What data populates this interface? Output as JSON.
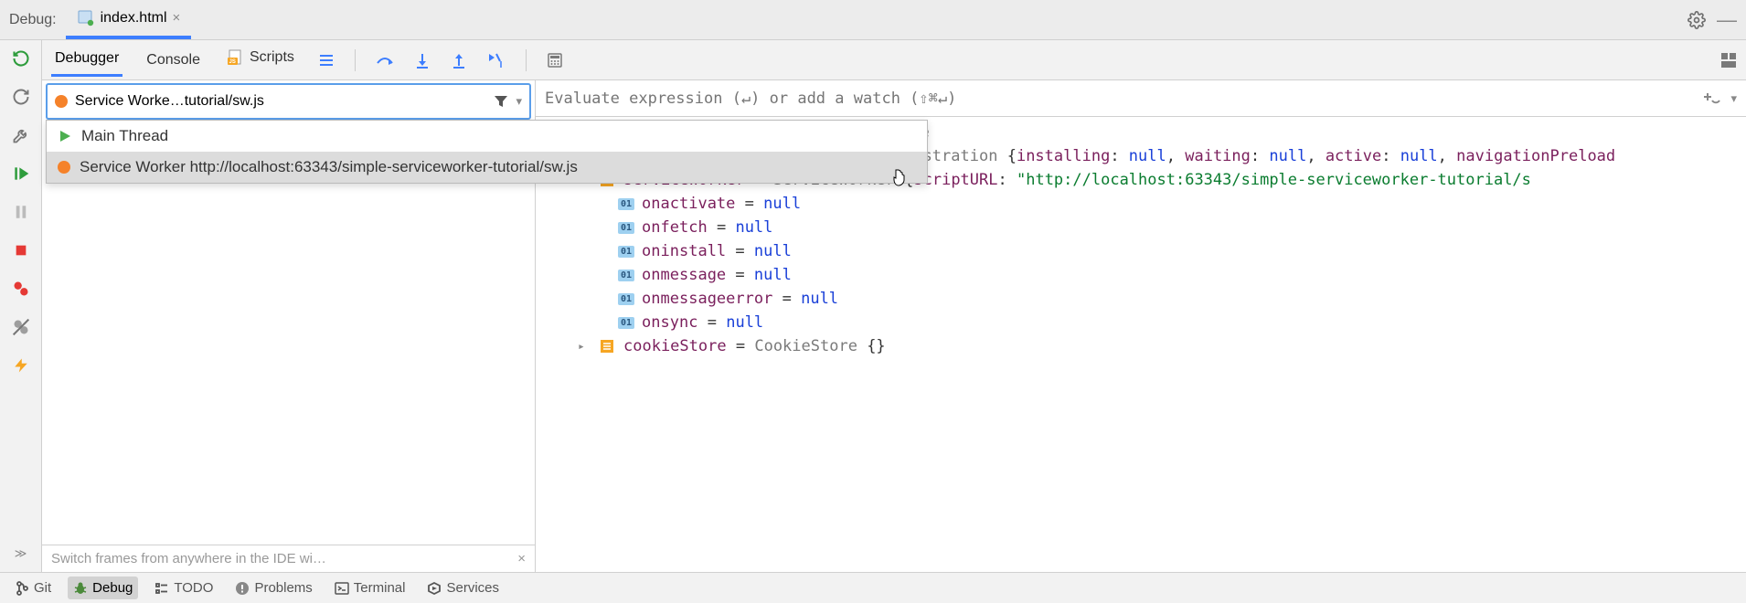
{
  "top": {
    "debug_label": "Debug:",
    "file_name": "index.html",
    "gear": "gear-icon",
    "min": "minimize-icon"
  },
  "toolrow": {
    "tabs": [
      "Debugger",
      "Console",
      "Scripts"
    ],
    "active_tab": 0
  },
  "frames": {
    "header_text": "Service Worke…tutorial/sw.js",
    "footer_hint": "Switch frames from anywhere in the IDE wi…",
    "dropdown": {
      "items": [
        {
          "icon": "play",
          "label": "Main Thread"
        },
        {
          "icon": "dot",
          "label": "Service Worker http://localhost:63343/simple-serviceworker-tutorial/sw.js"
        }
      ]
    }
  },
  "eval": {
    "placeholder": "Evaluate expression (↵) or add a watch (⇧⌘↵)"
  },
  "vars": {
    "scope_tail": "ope",
    "rows": [
      {
        "kind": "obj",
        "expand": true,
        "name": "registration",
        "type": "ServiceWorkerRegistration",
        "props": [
          {
            "k": "installing",
            "v": "null"
          },
          {
            "k": "waiting",
            "v": "null"
          },
          {
            "k": "active",
            "v": "null"
          },
          {
            "k": "navigationPreload",
            "tail": true
          }
        ]
      },
      {
        "kind": "obj",
        "expand": true,
        "name": "serviceWorker",
        "type": "ServiceWorker",
        "props": [
          {
            "k": "scriptURL",
            "s": "\"http://localhost:63343/simple-serviceworker-tutorial/s",
            "tail": true
          }
        ]
      },
      {
        "kind": "prim",
        "name": "onactivate",
        "val": "null"
      },
      {
        "kind": "prim",
        "name": "onfetch",
        "val": "null"
      },
      {
        "kind": "prim",
        "name": "oninstall",
        "val": "null"
      },
      {
        "kind": "prim",
        "name": "onmessage",
        "val": "null"
      },
      {
        "kind": "prim",
        "name": "onmessageerror",
        "val": "null"
      },
      {
        "kind": "prim",
        "name": "onsync",
        "val": "null"
      },
      {
        "kind": "obj",
        "expand": true,
        "name": "cookieStore",
        "type": "CookieStore",
        "props": [],
        "empty": true
      }
    ]
  },
  "bottom": {
    "items": [
      {
        "icon": "git",
        "label": "Git"
      },
      {
        "icon": "bug",
        "label": "Debug",
        "active": true
      },
      {
        "icon": "todo",
        "label": "TODO"
      },
      {
        "icon": "problems",
        "label": "Problems"
      },
      {
        "icon": "terminal",
        "label": "Terminal"
      },
      {
        "icon": "services",
        "label": "Services"
      }
    ]
  }
}
